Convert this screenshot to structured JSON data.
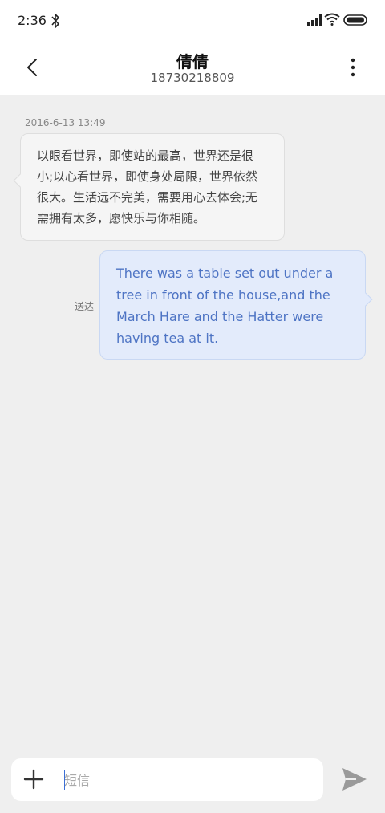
{
  "status_bar": {
    "time": "2:36",
    "icons": [
      "bluetooth-icon",
      "signal-icon",
      "wifi-icon",
      "battery-icon"
    ]
  },
  "header": {
    "contact_name": "倩倩",
    "contact_number": "18730218809",
    "icons": [
      "back-arrow-icon",
      "more-vertical-icon"
    ]
  },
  "conversation": {
    "timestamp": "2016-6-13 13:49",
    "incoming_message": "以眼看世界，即使站的最高，世界还是很小;以心看世界，即使身处局限，世界依然很大。生活远不完美，需要用心去体会;无需拥有太多，愿快乐与你相随。",
    "outgoing_message": "There was a table set out under a tree in front of the house,and the March Hare and the Hatter were having tea at it.",
    "delivery_status": "送达"
  },
  "input_bar": {
    "placeholder": "短信",
    "value": "",
    "icons": [
      "plus-icon",
      "send-icon"
    ]
  },
  "colors": {
    "outgoing_text": "#4e74c4",
    "outgoing_bubble": "#e3ebfb",
    "incoming_bubble": "#f5f5f5",
    "background": "#efefef"
  }
}
